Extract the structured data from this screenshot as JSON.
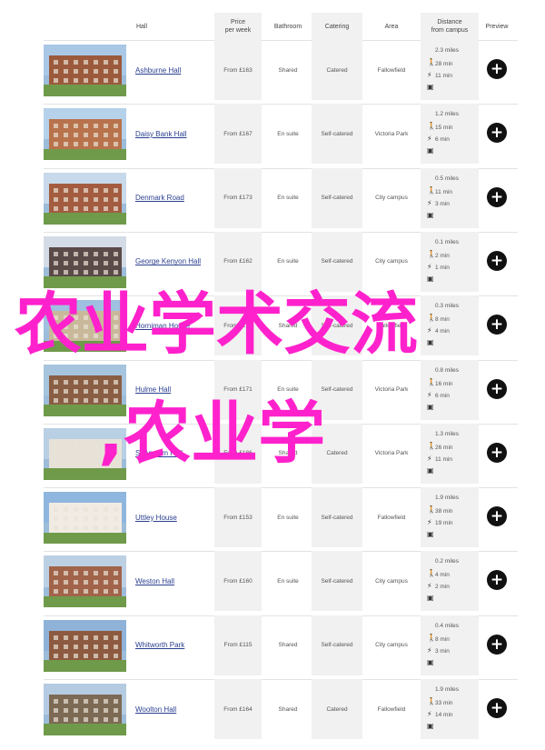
{
  "header": {
    "hall": "Hall",
    "price": "Price\nper week",
    "bathroom": "Bathroom",
    "catering": "Catering",
    "area": "Area",
    "distance": "Distance\nfrom campus",
    "preview": "Preview"
  },
  "rows": [
    {
      "name": "Ashburne Hall",
      "price": "From £163",
      "bathroom": "Shared",
      "catering": "Catered",
      "area": "Fallowfield",
      "walk": "2.3 miles",
      "cycle": "28 min",
      "bus": "11 min",
      "sky": "#a9c8e6",
      "bld": "#9c5a3c"
    },
    {
      "name": "Daisy Bank Hall",
      "price": "From £167",
      "bathroom": "En suite",
      "catering": "Self-catered",
      "area": "Victoria Park",
      "walk": "1.2 miles",
      "cycle": "15 min",
      "bus": "6 min",
      "sky": "#b6d2ea",
      "bld": "#b8734c"
    },
    {
      "name": "Denmark Road",
      "price": "From £173",
      "bathroom": "En suite",
      "catering": "Self-catered",
      "area": "City campus",
      "walk": "0.5 miles",
      "cycle": "11 min",
      "bus": "3 min",
      "sky": "#c7d9ea",
      "bld": "#a35c3f"
    },
    {
      "name": "George Kenyon Hall",
      "price": "From £162",
      "bathroom": "En suite",
      "catering": "Self-catered",
      "area": "City campus",
      "walk": "0.1 miles",
      "cycle": "2 min",
      "bus": "1 min",
      "sky": "#d3dce6",
      "bld": "#5a4a48"
    },
    {
      "name": "Horniman House",
      "price": "From £219",
      "bathroom": "Shared",
      "catering": "Self-catered",
      "area": "Fallowfield",
      "walk": "0.3 miles",
      "cycle": "8 min",
      "bus": "4 min",
      "sky": "#9fc0e0",
      "bld": "#c9b89a"
    },
    {
      "name": "Hulme Hall",
      "price": "From £171",
      "bathroom": "En suite",
      "catering": "Self-catered",
      "area": "Victoria Park",
      "walk": "0.8 miles",
      "cycle": "16 min",
      "bus": "6 min",
      "sky": "#a6c4de",
      "bld": "#8a5e44"
    },
    {
      "name": "St Anselm Hall",
      "price": "From £186",
      "bathroom": "Shared",
      "catering": "Catered",
      "area": "Victoria Park",
      "walk": "1.3 miles",
      "cycle": "26 min",
      "bus": "11 min",
      "sky": "#b9cfe4",
      "bld": "#e7e2d8"
    },
    {
      "name": "Uttley House",
      "price": "From £153",
      "bathroom": "En suite",
      "catering": "Self-catered",
      "area": "Fallowfield",
      "walk": "1.9 miles",
      "cycle": "38 min",
      "bus": "19 min",
      "sky": "#8fb6de",
      "bld": "#f0ece4"
    },
    {
      "name": "Weston Hall",
      "price": "From £160",
      "bathroom": "En suite",
      "catering": "Self-catered",
      "area": "City campus",
      "walk": "0.2 miles",
      "cycle": "4 min",
      "bus": "2 min",
      "sky": "#bcd0e4",
      "bld": "#a1644a"
    },
    {
      "name": "Whitworth Park",
      "price": "From £115",
      "bathroom": "Shared",
      "catering": "Self-catered",
      "area": "City campus",
      "walk": "0.4 miles",
      "cycle": "8 min",
      "bus": "3 min",
      "sky": "#8fb2d8",
      "bld": "#8d5a40"
    },
    {
      "name": "Woolton Hall",
      "price": "From £164",
      "bathroom": "Shared",
      "catering": "Catered",
      "area": "Fallowfield",
      "walk": "1.9 miles",
      "cycle": "33 min",
      "bus": "14 min",
      "sky": "#b4cbe2",
      "bld": "#7d6a55"
    }
  ],
  "icons": {
    "walk": "walking-icon",
    "cycle": "bicycle-icon",
    "bus": "bus-icon",
    "preview": "plus-icon"
  },
  "overlay": {
    "line1": "农业学术交流",
    "line2": ",农业学"
  },
  "colors": {
    "accent": "#ff22cc",
    "link": "#2a3f8f",
    "shade": "#f1f1f1"
  }
}
